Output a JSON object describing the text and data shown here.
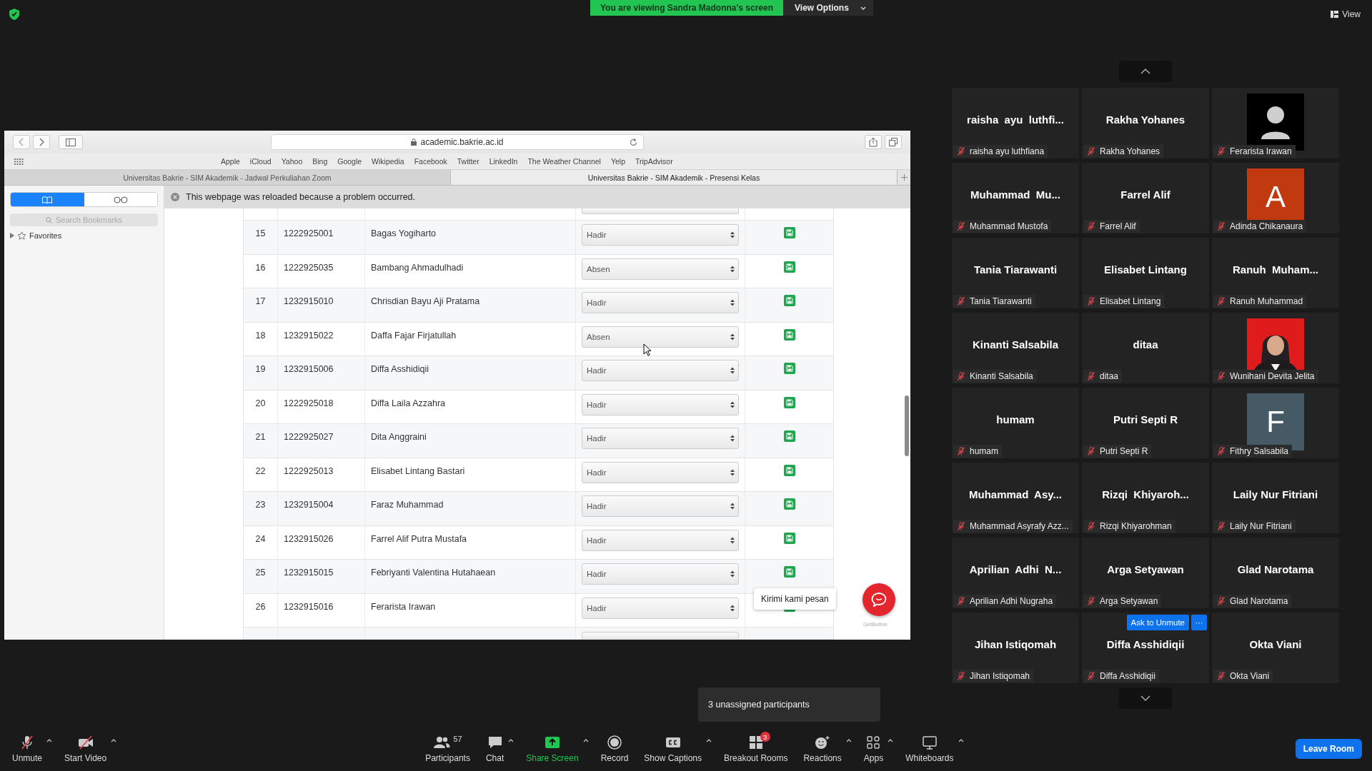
{
  "banner": {
    "text": "You are viewing Sandra Madonna's screen",
    "options": "View Options",
    "view": "View"
  },
  "browser": {
    "address": "academic.bakrie.ac.id",
    "bookmarks": [
      "Apple",
      "iCloud",
      "Yahoo",
      "Bing",
      "Google",
      "Wikipedia",
      "Facebook",
      "Twitter",
      "LinkedIn",
      "The Weather Channel",
      "Yelp",
      "TripAdvisor"
    ],
    "tabs": [
      {
        "label": "Universitas Bakrie - SIM Akademik - Jadwal Perkuliahan Zoom",
        "selected": false
      },
      {
        "label": "Universitas Bakrie - SIM Akademik - Presensi Kelas",
        "selected": true
      }
    ],
    "sidebar": {
      "segments": [
        {
          "kind": "bookmarks",
          "selected": true
        },
        {
          "kind": "reading",
          "selected": false
        }
      ],
      "search": {
        "placeholder": "Search Bookmarks"
      },
      "tree": [
        {
          "label": "Favorites",
          "expanded": false
        }
      ]
    },
    "notice": "This webpage was reloaded because a problem occurred.",
    "table": {
      "rows": [
        {
          "number": "15",
          "id": "1222925001",
          "name": "Bagas Yogiharto",
          "status": "Hadir"
        },
        {
          "number": "16",
          "id": "1222925035",
          "name": "Bambang Ahmadulhadi",
          "status": "Absen"
        },
        {
          "number": "17",
          "id": "1232915010",
          "name": "Chrisdian Bayu Aji Pratama",
          "status": "Hadir"
        },
        {
          "number": "18",
          "id": "1232915022",
          "name": "Daffa Fajar Firjatullah",
          "status": "Absen"
        },
        {
          "number": "19",
          "id": "1232915006",
          "name": "Diffa Asshidiqii",
          "status": "Hadir"
        },
        {
          "number": "20",
          "id": "1222925018",
          "name": "Diffa Laila Azzahra",
          "status": "Hadir"
        },
        {
          "number": "21",
          "id": "1222925027",
          "name": "Dita Anggraini",
          "status": "Hadir"
        },
        {
          "number": "22",
          "id": "1222925013",
          "name": "Elisabet Lintang Bastari",
          "status": "Hadir"
        },
        {
          "number": "23",
          "id": "1232915004",
          "name": "Faraz Muhammad",
          "status": "Hadir"
        },
        {
          "number": "24",
          "id": "1232915026",
          "name": "Farrel Alif Putra Mustafa",
          "status": "Hadir"
        },
        {
          "number": "25",
          "id": "1232915015",
          "name": "Febriyanti Valentina Hutahaean",
          "status": "Hadir"
        },
        {
          "number": "26",
          "id": "1232915016",
          "name": "Ferarista Irawan",
          "status": "Hadir"
        }
      ]
    },
    "chat_widget": {
      "bubble": "Kirimi kami pesan",
      "brand": "GetButton"
    }
  },
  "tiles": [
    {
      "kind": "name",
      "display": "raisha  ayu  luthfi...",
      "label": "raisha ayu luthfiana",
      "muted": true
    },
    {
      "kind": "name",
      "display": "Rakha Yohanes",
      "label": "Rakha Yohanes",
      "muted": true
    },
    {
      "kind": "silhouette",
      "label": "Ferarista Irawan",
      "muted": true
    },
    {
      "kind": "name",
      "display": "Muhammad  Mu...",
      "label": "Muhammad Mustofa",
      "muted": true
    },
    {
      "kind": "name",
      "display": "Farrel Alif",
      "label": "Farrel Alif",
      "muted": true
    },
    {
      "kind": "letter",
      "letter": "A",
      "color": "#c1390e",
      "label": "Adinda Chikanaura",
      "muted": true
    },
    {
      "kind": "name",
      "display": "Tania Tiarawanti",
      "label": "Tania Tiarawanti",
      "muted": true
    },
    {
      "kind": "name",
      "display": "Elisabet Lintang",
      "label": "Elisabet Lintang",
      "muted": true
    },
    {
      "kind": "name",
      "display": "Ranuh  Muham...",
      "label": "Ranuh Muhammad",
      "muted": true
    },
    {
      "kind": "name",
      "display": "Kinanti Salsabila",
      "label": "Kinanti Salsabila",
      "muted": true
    },
    {
      "kind": "name",
      "display": "ditaa",
      "label": "ditaa",
      "muted": true
    },
    {
      "kind": "picture",
      "label": "Wunihani Devita Jelita",
      "muted": true
    },
    {
      "kind": "name",
      "display": "humam",
      "label": "humam",
      "muted": true
    },
    {
      "kind": "name",
      "display": "Putri Septi R",
      "label": "Putri Septi R",
      "muted": true
    },
    {
      "kind": "letter",
      "letter": "F",
      "color": "#455a64",
      "label": "Fithry Salsabila",
      "muted": true
    },
    {
      "kind": "name",
      "display": "Muhammad  Asy...",
      "label": "Muhammad Asyrafy Azz...",
      "muted": true
    },
    {
      "kind": "name",
      "display": "Rizqi  Khiyaroh...",
      "label": "Rizqi Khiyarohman",
      "muted": true
    },
    {
      "kind": "name",
      "display": "Laily Nur Fitriani",
      "label": "Laily Nur Fitriani",
      "muted": true
    },
    {
      "kind": "name",
      "display": "Aprilian  Adhi  N...",
      "label": "Aprilian Adhi Nugraha",
      "muted": true
    },
    {
      "kind": "name",
      "display": "Arga Setyawan",
      "label": "Arga Setyawan",
      "muted": true
    },
    {
      "kind": "name",
      "display": "Glad Narotama",
      "label": "Glad Narotama",
      "muted": true
    },
    {
      "kind": "name",
      "display": "Jihan Istiqomah",
      "label": "Jihan Istiqomah",
      "muted": true
    },
    {
      "kind": "name",
      "display": "Diffa Asshidiqii",
      "label": "Diffa Asshidiqii",
      "muted": true,
      "hovered": true
    },
    {
      "kind": "name",
      "display": "Okta Viani",
      "label": "Okta Viani",
      "muted": true
    }
  ],
  "tile_hover_actions": {
    "ask": "Ask to Unmute",
    "more": "···"
  },
  "popup": "3 unassigned participants",
  "toolbar": [
    {
      "kind": "mic",
      "label": "Unmute",
      "caret": true
    },
    {
      "kind": "video",
      "label": "Start Video",
      "caret": true
    },
    {
      "kind": "participants",
      "label": "Participants",
      "count": "57",
      "caret": false
    },
    {
      "kind": "chat",
      "label": "Chat",
      "caret": true
    },
    {
      "kind": "share",
      "label": "Share Screen",
      "caret": true
    },
    {
      "kind": "record",
      "label": "Record",
      "caret": false
    },
    {
      "kind": "captions",
      "label": "Show Captions",
      "caret": true
    },
    {
      "kind": "breakout",
      "label": "Breakout Rooms",
      "badge": "3",
      "caret": false
    },
    {
      "kind": "reactions",
      "label": "Reactions",
      "caret": true
    },
    {
      "kind": "apps",
      "label": "Apps",
      "caret": true
    },
    {
      "kind": "whiteboard",
      "label": "Whiteboards",
      "caret": true
    }
  ],
  "leave": "Leave Room"
}
